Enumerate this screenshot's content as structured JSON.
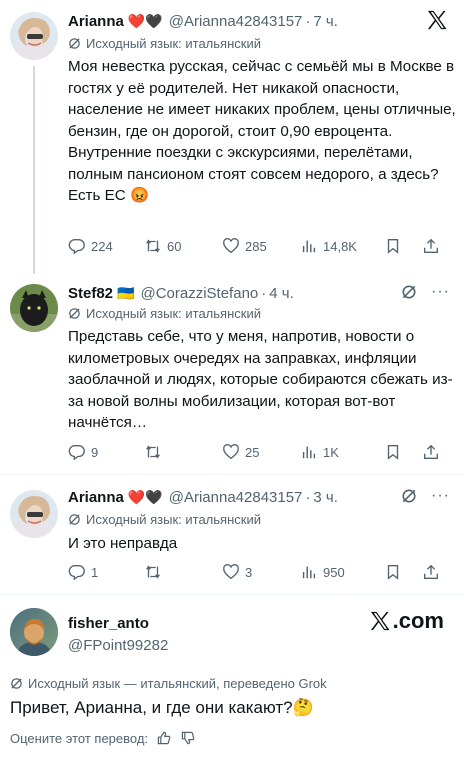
{
  "tweets": [
    {
      "name": "Arianna",
      "badges": "❤️🖤",
      "handle": "@Arianna42843157",
      "time": "7 ч.",
      "source_lang": "Исходный язык: итальянский",
      "text": "Моя невестка русская, сейчас с семьёй мы в Москве в гостях у её родителей. Нет никакой опасности, население не имеет никаких проблем, цены отличные, бензин, где он дорогой, стоит 0,90 евроцента. Внутренние поездки с экскурсиями, перелётами, полным пансионом стоят совсем недорого, а здесь? Есть ЕС 😡",
      "replies": "224",
      "reposts": "60",
      "likes": "285",
      "views": "14,8K"
    },
    {
      "name": "Stef82",
      "badges": "🇺🇦",
      "handle": "@CorazziStefano",
      "time": "4 ч.",
      "source_lang": "Исходный язык: итальянский",
      "text": "Представь себе, что у меня, напротив, новости о километровых очередях на заправках, инфляции заоблачной и людях, которые собираются сбежать из-за новой волны мобилизации, которая вот-вот начнётся…",
      "replies": "9",
      "reposts": "",
      "likes": "25",
      "views": "1K"
    },
    {
      "name": "Arianna",
      "badges": "❤️🖤",
      "handle": "@Arianna42843157",
      "time": "3 ч.",
      "source_lang": "Исходный язык: итальянский",
      "text": "И это неправда",
      "replies": "1",
      "reposts": "",
      "likes": "3",
      "views": "950"
    }
  ],
  "final_tweet": {
    "name": "fisher_anto",
    "handle": "@FPoint99282",
    "xcom": ".com",
    "translated_line": "Исходный язык — итальянский, переведено Grok",
    "text": "Привет, Арианна, и где они какают?🤔",
    "rate_label": "Оцените этот перевод:"
  },
  "icons": {
    "top_logo": "x-logo-icon",
    "reply": "reply-icon",
    "repost": "repost-icon",
    "like": "heart-icon",
    "views": "views-icon",
    "bookmark": "bookmark-icon",
    "share": "share-icon",
    "grok": "grok-icon",
    "more": "more-icon"
  },
  "colors": {
    "text": "#0f1419",
    "muted": "#536471",
    "divider": "#eff3f4"
  }
}
